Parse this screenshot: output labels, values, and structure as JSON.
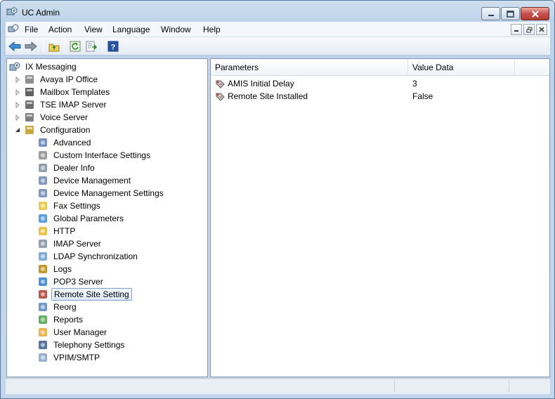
{
  "window": {
    "title": "UC Admin"
  },
  "menubar": {
    "items": [
      "File",
      "Action",
      "View",
      "Language",
      "Window",
      "Help"
    ]
  },
  "toolbar": {
    "buttons": [
      "back-arrow-icon",
      "forward-arrow-icon",
      "up-folder-icon",
      "refresh-icon",
      "export-list-icon",
      "help-icon"
    ]
  },
  "tree": {
    "root": "IX Messaging",
    "top_items": [
      "Avaya IP Office",
      "Mailbox Templates",
      "TSE IMAP Server",
      "Voice Server",
      "Configuration"
    ],
    "config_items": [
      "Advanced",
      "Custom Interface Settings",
      "Dealer Info",
      "Device Management",
      "Device Management Settings",
      "Fax Settings",
      "Global Parameters",
      "HTTP",
      "IMAP Server",
      "LDAP Synchronization",
      "Logs",
      "POP3 Server",
      "Remote Site Setting",
      "Reorg",
      "Reports",
      "User Manager",
      "Telephony Settings",
      "VPIM/SMTP"
    ],
    "selected": "Remote Site Setting"
  },
  "list": {
    "columns": [
      "Parameters",
      "Value Data"
    ],
    "rows": [
      {
        "param": "AMIS Initial Delay",
        "value": "3"
      },
      {
        "param": "Remote Site Installed",
        "value": "False"
      }
    ]
  },
  "colors": {
    "selection": "#dde9f7",
    "accent": "#3a6ea5"
  }
}
